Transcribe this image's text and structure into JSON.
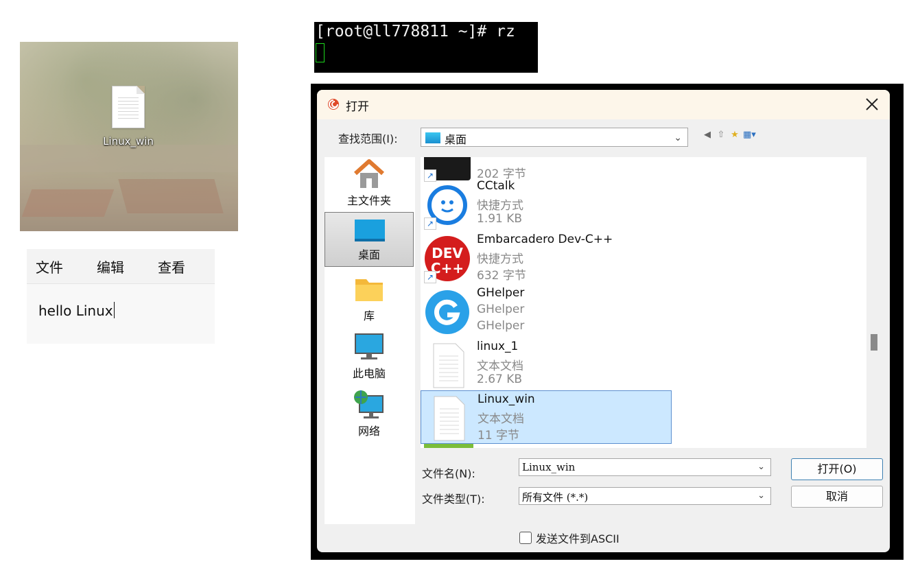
{
  "desktop": {
    "icon_label": "Linux_win"
  },
  "notepad": {
    "menu": [
      "文件",
      "编辑",
      "查看"
    ],
    "content": "hello Linux"
  },
  "terminal": {
    "line": "[root@ll778811 ~]# rz"
  },
  "dialog": {
    "title": "打开",
    "look_in_label": "查找范围(I):",
    "look_in_value": "桌面",
    "places": [
      "主文件夹",
      "桌面",
      "库",
      "此电脑",
      "网络"
    ],
    "files": [
      {
        "name": "",
        "type": "",
        "size": "202 字节"
      },
      {
        "name": "CCtalk",
        "type": "快捷方式",
        "size": "1.91 KB"
      },
      {
        "name": "Embarcadero Dev-C++",
        "type": "快捷方式",
        "size": "632 字节"
      },
      {
        "name": "GHelper",
        "type": "GHelper",
        "size": "GHelper"
      },
      {
        "name": "linux_1",
        "type": "文本文档",
        "size": "2.67 KB"
      },
      {
        "name": "Linux_win",
        "type": "文本文档",
        "size": "11 字节"
      }
    ],
    "filename_label": "文件名(N):",
    "filename_value": "Linux_win",
    "filetype_label": "文件类型(T):",
    "filetype_value": "所有文件 (*.*)",
    "open_button": "打开(O)",
    "cancel_button": "取消",
    "ascii_checkbox": "发送文件到ASCII"
  },
  "colors": {
    "selection": "#cce8ff",
    "terminal_cursor": "#1dd81d"
  }
}
